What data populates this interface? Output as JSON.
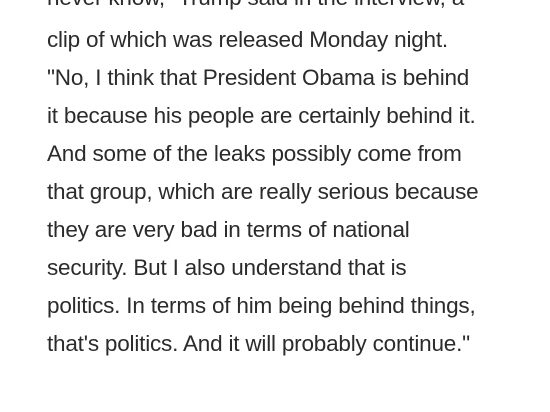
{
  "article": {
    "lines": [
      "never know,\" Trump said in the interview, a",
      "clip of which was released Monday night.",
      "\"No, I think that President Obama is behind",
      "it because his people are certainly behind it.",
      "And some of the leaks possibly come from",
      "that group, which are really serious because",
      "they are very bad in terms of national",
      "security. But I also understand that is",
      "politics. In terms of him being behind things,",
      "that's politics. And it will probably continue.\""
    ]
  }
}
